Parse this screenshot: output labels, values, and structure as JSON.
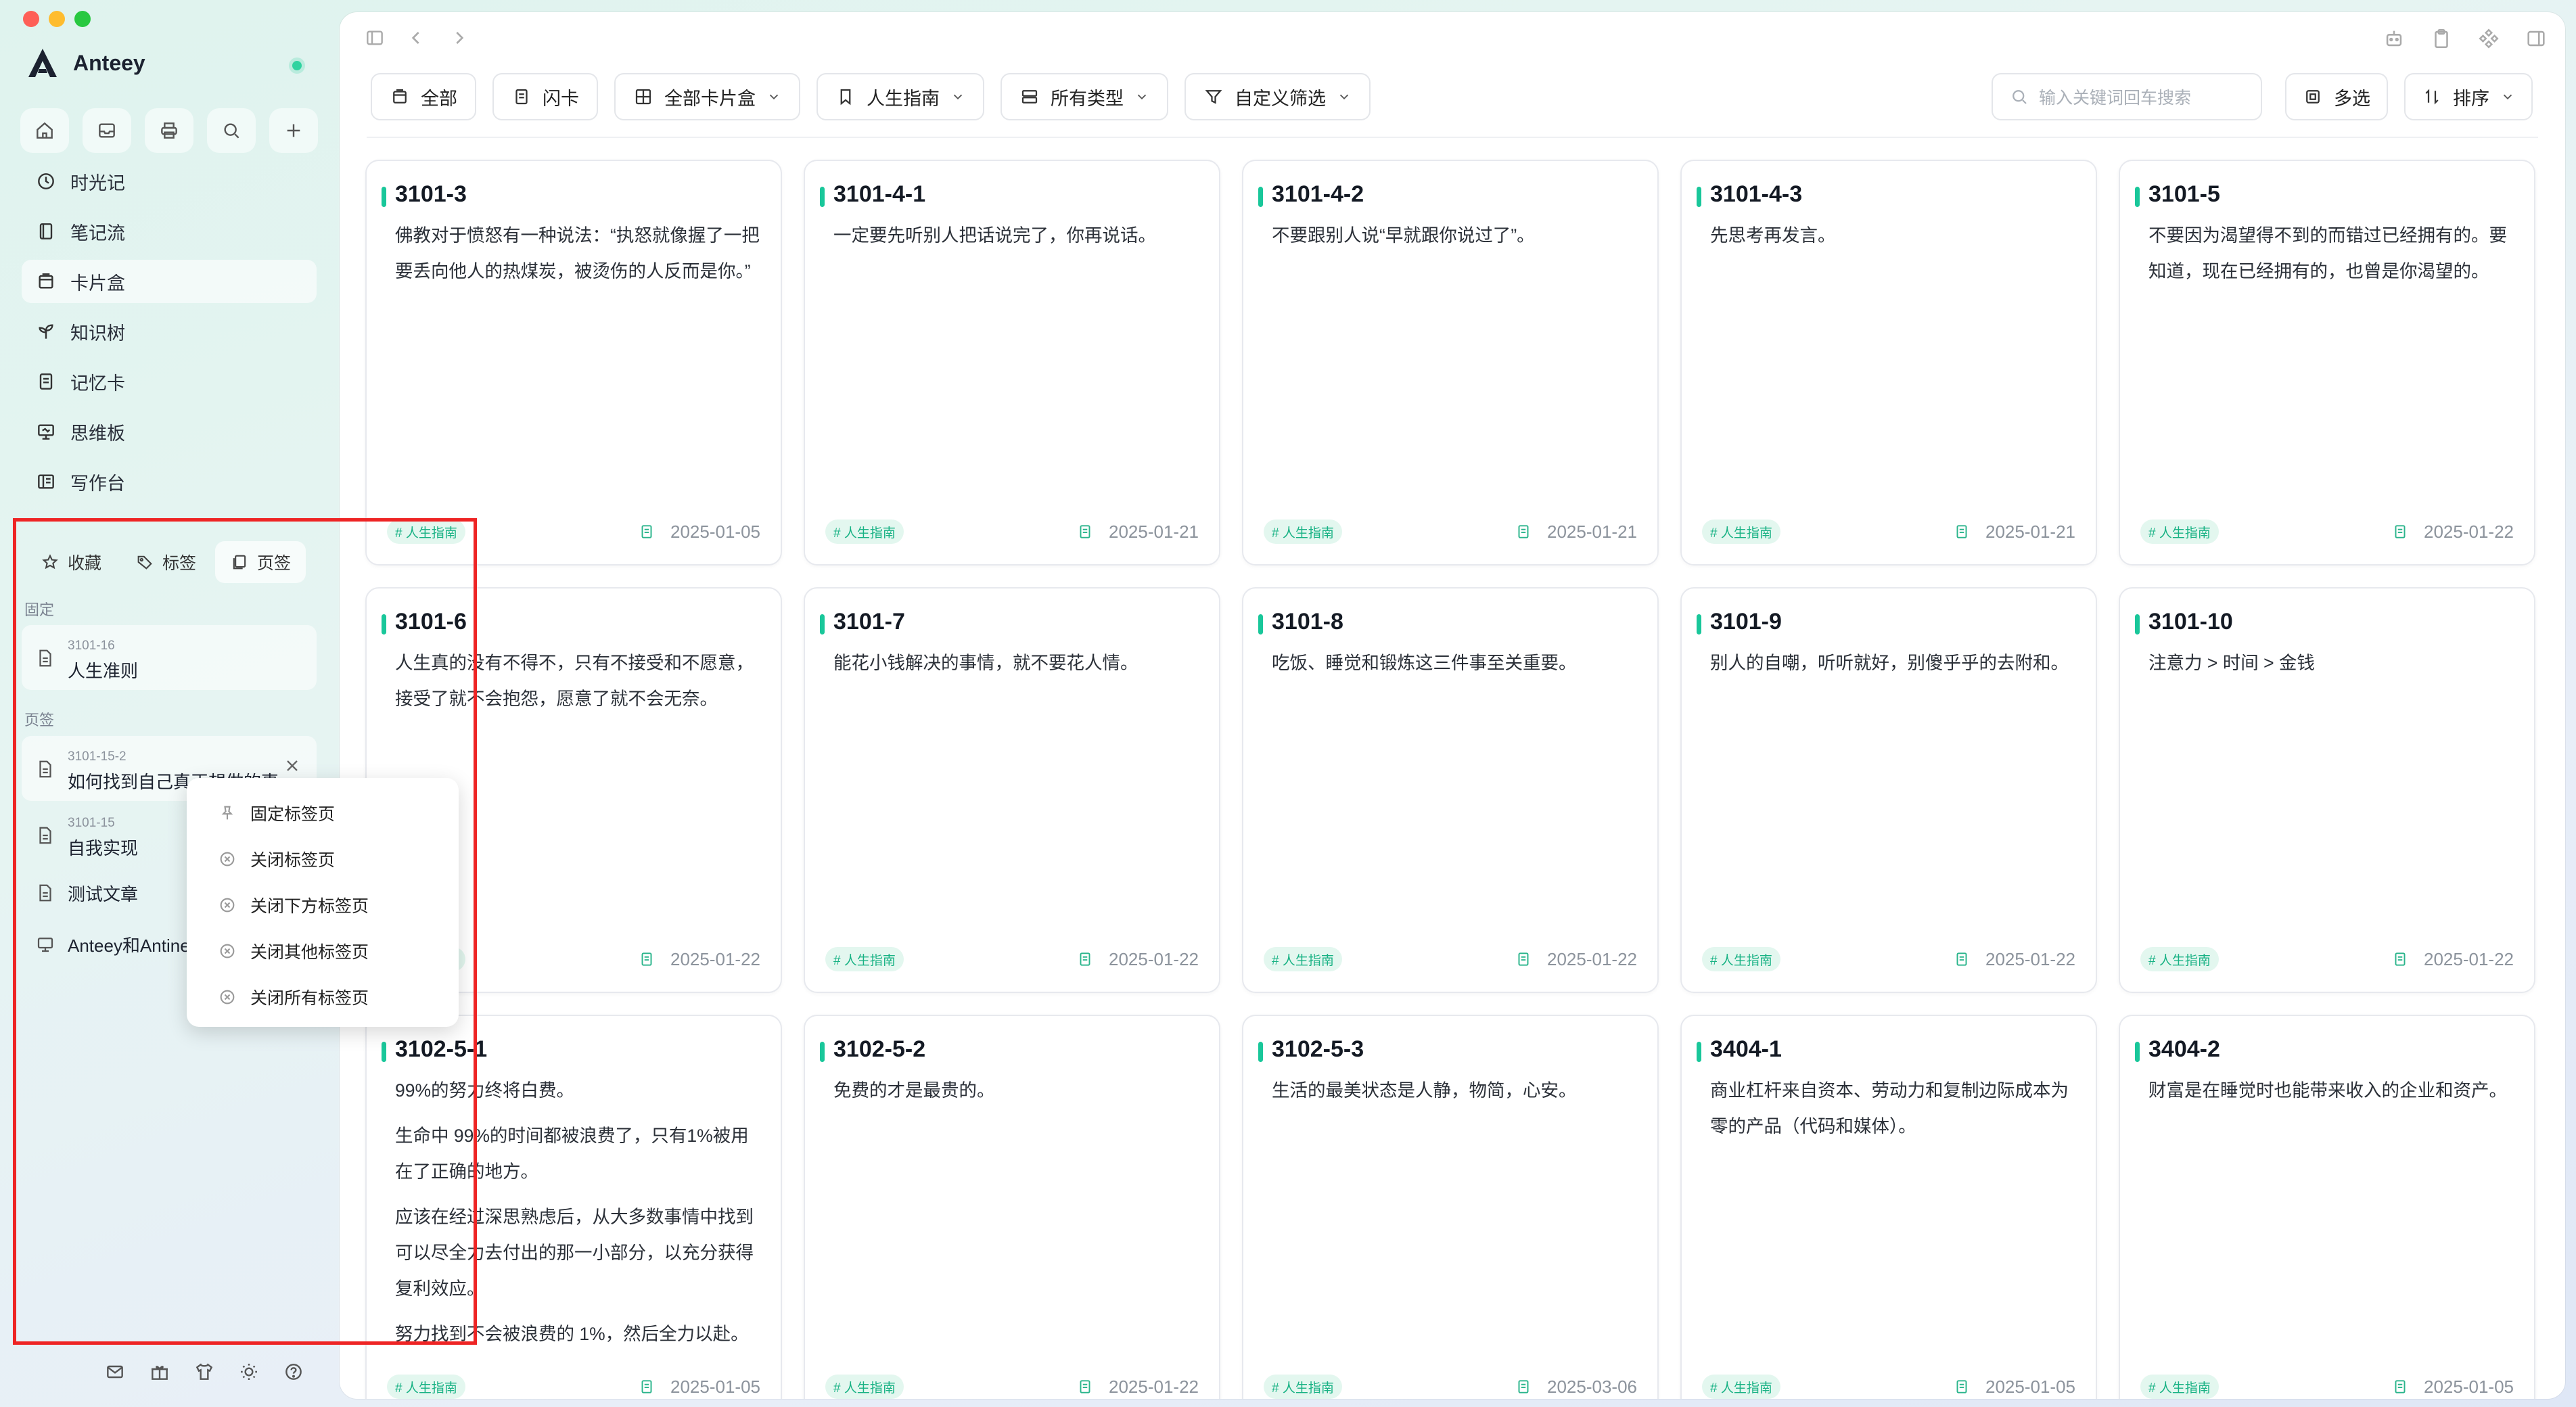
{
  "app": {
    "name": "Anteey"
  },
  "sidebar": {
    "nav": [
      {
        "label": "时光记",
        "icon": "clock-icon"
      },
      {
        "label": "笔记流",
        "icon": "notebook-icon"
      },
      {
        "label": "卡片盒",
        "icon": "card-box-icon",
        "active": true
      },
      {
        "label": "知识树",
        "icon": "sprout-icon"
      },
      {
        "label": "记忆卡",
        "icon": "memory-card-icon"
      },
      {
        "label": "思维板",
        "icon": "whiteboard-icon"
      },
      {
        "label": "写作台",
        "icon": "writing-desk-icon"
      }
    ],
    "panel_tabs": {
      "favorites": "收藏",
      "tags": "标签",
      "pages": "页签"
    },
    "pinned_label": "固定",
    "pinned": {
      "sub": "3101-16",
      "title": "人生准则"
    },
    "tabs_label": "页签",
    "tabs": [
      {
        "sub": "3101-15-2",
        "title": "如何找到自己真正想做的事"
      },
      {
        "sub": "3101-15",
        "title": "自我实现"
      }
    ],
    "simple_items": [
      {
        "title": "测试文章"
      },
      {
        "title": "Anteey和Antinet"
      }
    ]
  },
  "context_menu": [
    {
      "label": "固定标签页",
      "icon": "pin-icon"
    },
    {
      "label": "关闭标签页",
      "icon": "close-circle-icon"
    },
    {
      "label": "关闭下方标签页",
      "icon": "close-circle-icon"
    },
    {
      "label": "关闭其他标签页",
      "icon": "close-circle-icon"
    },
    {
      "label": "关闭所有标签页",
      "icon": "close-circle-icon"
    }
  ],
  "filters": {
    "all": "全部",
    "flashcard": "闪卡",
    "all_boxes": "全部卡片盒",
    "life_guide": "人生指南",
    "all_types": "所有类型",
    "custom_filter": "自定义筛选",
    "search_placeholder": "输入关键词回车搜索",
    "multi_select": "多选",
    "sort": "排序"
  },
  "cards": [
    {
      "id": "3101-3",
      "body": [
        "佛教对于愤怒有一种说法：“执怒就像握了一把要丢向他人的热煤炭，被烫伤的人反而是你。”"
      ],
      "tag": "# 人生指南",
      "date": "2025-01-05"
    },
    {
      "id": "3101-4-1",
      "body": [
        "一定要先听别人把话说完了，你再说话。"
      ],
      "tag": "# 人生指南",
      "date": "2025-01-21"
    },
    {
      "id": "3101-4-2",
      "body": [
        "不要跟别人说“早就跟你说过了”。"
      ],
      "tag": "# 人生指南",
      "date": "2025-01-21"
    },
    {
      "id": "3101-4-3",
      "body": [
        "先思考再发言。"
      ],
      "tag": "# 人生指南",
      "date": "2025-01-21"
    },
    {
      "id": "3101-5",
      "body": [
        "不要因为渴望得不到的而错过已经拥有的。要知道，现在已经拥有的，也曾是你渴望的。"
      ],
      "tag": "# 人生指南",
      "date": "2025-01-22"
    },
    {
      "id": "3101-6",
      "body": [
        "人生真的没有不得不，只有不接受和不愿意，接受了就不会抱怨，愿意了就不会无奈。"
      ],
      "tag": "# 人生指南",
      "date": "2025-01-22"
    },
    {
      "id": "3101-7",
      "body": [
        "能花小钱解决的事情，就不要花人情。"
      ],
      "tag": "# 人生指南",
      "date": "2025-01-22"
    },
    {
      "id": "3101-8",
      "body": [
        "吃饭、睡觉和锻炼这三件事至关重要。"
      ],
      "tag": "# 人生指南",
      "date": "2025-01-22"
    },
    {
      "id": "3101-9",
      "body": [
        "别人的自嘲，听听就好，别傻乎乎的去附和。"
      ],
      "tag": "# 人生指南",
      "date": "2025-01-22"
    },
    {
      "id": "3101-10",
      "body": [
        "注意力 > 时间 > 金钱"
      ],
      "tag": "# 人生指南",
      "date": "2025-01-22"
    },
    {
      "id": "3102-5-1",
      "body": [
        "99%的努力终将白费。",
        "生命中 99%的时间都被浪费了，只有1%被用在了正确的地方。",
        "应该在经过深思熟虑后，从大多数事情中找到可以尽全力去付出的那一小部分，以充分获得复利效应。",
        "努力找到不会被浪费的 1%，然后全力以赴。"
      ],
      "tag": "# 人生指南",
      "date": "2025-01-05"
    },
    {
      "id": "3102-5-2",
      "body": [
        "免费的才是最贵的。"
      ],
      "tag": "# 人生指南",
      "date": "2025-01-22"
    },
    {
      "id": "3102-5-3",
      "body": [
        "生活的最美状态是人静，物简，心安。"
      ],
      "tag": "# 人生指南",
      "date": "2025-03-06"
    },
    {
      "id": "3404-1",
      "body": [
        "商业杠杆来自资本、劳动力和复制边际成本为零的产品（代码和媒体）。"
      ],
      "tag": "# 人生指南",
      "date": "2025-01-05"
    },
    {
      "id": "3404-2",
      "body": [
        "财富是在睡觉时也能带来收入的企业和资产。"
      ],
      "tag": "# 人生指南",
      "date": "2025-01-05"
    }
  ]
}
